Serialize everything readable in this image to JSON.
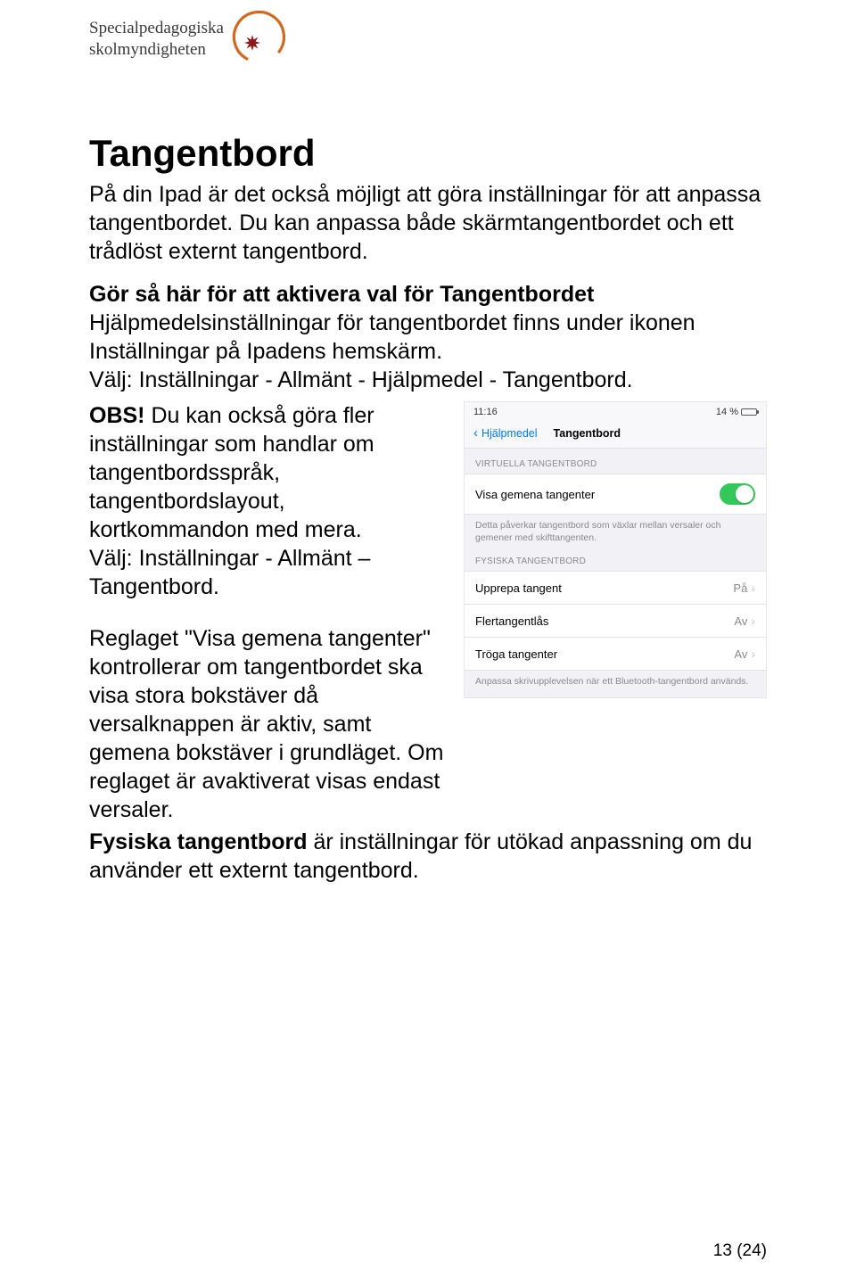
{
  "logo": {
    "line1": "Specialpedagogiska",
    "line2": "skolmyndigheten"
  },
  "title": "Tangentbord",
  "para_intro": "På din Ipad är det också möjligt att göra inställningar för att anpassa tangentbordet. Du kan anpassa både skärmtangentbordet och ett trådlöst externt tangentbord.",
  "subhead": "Gör så här för att aktivera val för Tangentbordet",
  "para_where": "Hjälpmedelsinställningar för tangentbordet finns under ikonen Inställningar på Ipadens hemskärm.",
  "para_path1": "Välj: Inställningar - Allmänt - Hjälpmedel - Tangentbord.",
  "obs_label": "OBS!",
  "para_obs_rest": " Du kan också göra fler inställningar som handlar om tangentbordsspråk, tangentbordslayout, kortkommandon med mera.",
  "para_path2": "Välj: Inställningar - Allmänt – Tangentbord.",
  "para_reglage": "Reglaget \"Visa gemena tangenter\" kontrollerar om tangentbordet ska visa stora bokstäver då versalknappen är aktiv, samt gemena bokstäver i grundläget. Om reglaget är avaktiverat visas endast versaler.",
  "fysiska_bold": "Fysiska tangentbord",
  "fysiska_rest": " är inställningar för utökad anpassning om du använder ett externt tangentbord.",
  "page_number": "13 (24)",
  "ios": {
    "time": "11:16",
    "battery_pct": "14 %",
    "back": "Hjälpmedel",
    "navtitle": "Tangentbord",
    "section1": "VIRTUELLA TANGENTBORD",
    "row_visa": "Visa gemena tangenter",
    "desc1": "Detta påverkar tangentbord som växlar mellan versaler och gemener med skifttangenten.",
    "section2": "FYSISKA TANGENTBORD",
    "row_upprepa": "Upprepa tangent",
    "row_upprepa_val": "På",
    "row_flertang": "Flertangentlås",
    "row_flertang_val": "Av",
    "row_troga": "Tröga tangenter",
    "row_troga_val": "Av",
    "desc2": "Anpassa skrivupplevelsen när ett Bluetooth-tangentbord används."
  }
}
